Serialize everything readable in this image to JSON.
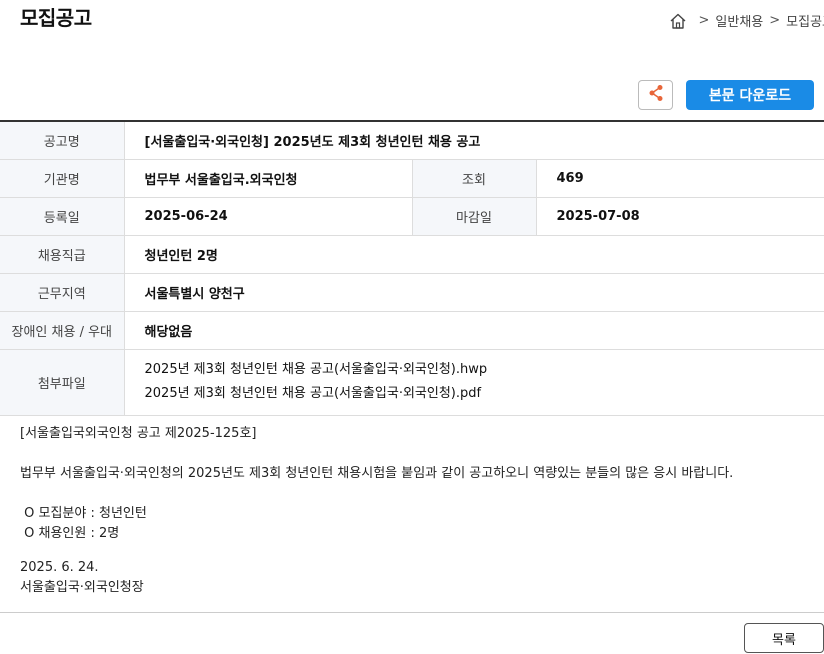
{
  "header": {
    "title": "모집공고",
    "breadcrumb": {
      "sep1": ">",
      "item1": "일반채용",
      "sep2": ">",
      "item2": "모집공고"
    }
  },
  "actions": {
    "download_label": "본문 다운로드"
  },
  "info": {
    "title_label": "공고명",
    "title_value": "[서울출입국·외국인청] 2025년도 제3회 청년인턴 채용 공고",
    "org_label": "기관명",
    "org_value": "법무부 서울출입국.외국인청",
    "views_label": "조회",
    "views_value": "469",
    "reg_label": "등록일",
    "reg_value": "2025-06-24",
    "deadline_label": "마감일",
    "deadline_value": "2025-07-08",
    "grade_label": "채용직급",
    "grade_value": "청년인턴 2명",
    "location_label": "근무지역",
    "location_value": "서울특별시 양천구",
    "disability_label": "장애인 채용 / 우대",
    "disability_value": "해당없음",
    "files_label": "첨부파일",
    "files": [
      "2025년 제3회 청년인턴 채용 공고(서울출입국·외국인청).hwp",
      "2025년 제3회 청년인턴 채용 공고(서울출입국·외국인청).pdf"
    ]
  },
  "body": {
    "line1": "[서울출입국외국인청 공고 제2025-125호]",
    "line2": "법무부 서울출입국·외국인청의 2025년도 제3회 청년인턴 채용시험을 붙임과 같이 공고하오니 역량있는 분들의 많은 응시 바랍니다.",
    "line3": " O 모집분야 : 청년인턴",
    "line4": " O 채용인원 : 2명",
    "line5": "2025. 6. 24.",
    "line6": "서울출입국·외국인청장"
  },
  "footer": {
    "list_label": "목록"
  },
  "colors": {
    "accent": "#1a8be6",
    "share_icon": "#e8663a"
  }
}
